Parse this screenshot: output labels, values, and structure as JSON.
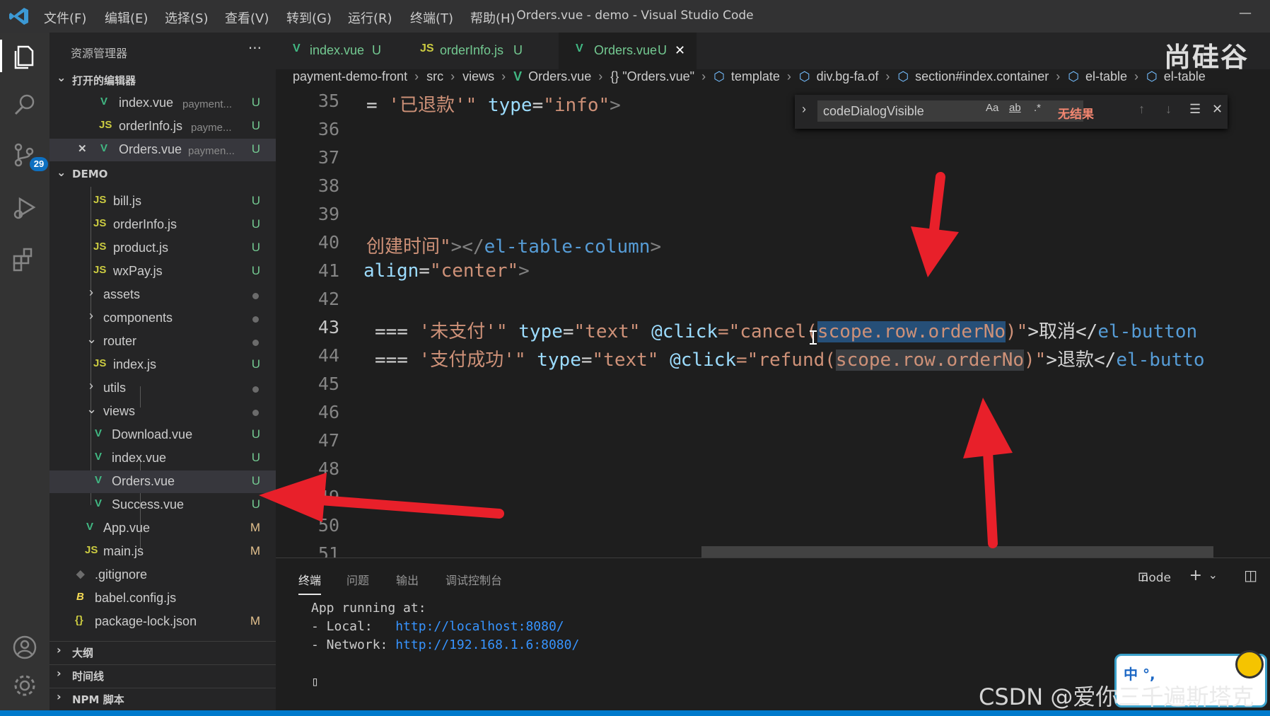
{
  "menu": [
    "文件(F)",
    "编辑(E)",
    "选择(S)",
    "查看(V)",
    "转到(G)",
    "运行(R)",
    "终端(T)",
    "帮助(H)"
  ],
  "window_title": "Orders.vue - demo - Visual Studio Code",
  "activity": {
    "scm_badge": "29"
  },
  "sidebar": {
    "title": "资源管理器",
    "more": "···",
    "open_editors_label": "打开的编辑器",
    "open_editors": [
      {
        "name": "index.vue",
        "hint": "payment...",
        "status": "U",
        "kind": "vue"
      },
      {
        "name": "orderInfo.js",
        "hint": "payme...",
        "status": "U",
        "kind": "js"
      },
      {
        "name": "Orders.vue",
        "hint": "paymen...",
        "status": "U",
        "kind": "vue"
      }
    ],
    "workspace_label": "DEMO",
    "files": [
      {
        "name": "bill.js",
        "status": "U",
        "kind": "js"
      },
      {
        "name": "orderInfo.js",
        "status": "U",
        "kind": "js"
      },
      {
        "name": "product.js",
        "status": "U",
        "kind": "js"
      },
      {
        "name": "wxPay.js",
        "status": "U",
        "kind": "js"
      },
      {
        "name": "assets",
        "kind": "folder-closed"
      },
      {
        "name": "components",
        "kind": "folder-closed"
      },
      {
        "name": "router",
        "kind": "folder-open"
      },
      {
        "name": "index.js",
        "status": "U",
        "kind": "js"
      },
      {
        "name": "utils",
        "kind": "folder-closed"
      },
      {
        "name": "views",
        "kind": "folder-open"
      },
      {
        "name": "Download.vue",
        "status": "U",
        "kind": "vue"
      },
      {
        "name": "index.vue",
        "status": "U",
        "kind": "vue"
      },
      {
        "name": "Orders.vue",
        "status": "U",
        "kind": "vue"
      },
      {
        "name": "Success.vue",
        "status": "U",
        "kind": "vue"
      },
      {
        "name": "App.vue",
        "status": "M",
        "kind": "vue"
      },
      {
        "name": "main.js",
        "status": "M",
        "kind": "js"
      },
      {
        "name": ".gitignore",
        "kind": "git"
      },
      {
        "name": "babel.config.js",
        "kind": "babel"
      },
      {
        "name": "package-lock.json",
        "status": "M",
        "kind": "json"
      }
    ],
    "outline_label": "大纲",
    "timeline_label": "时间线",
    "npm_label": "NPM 脚本"
  },
  "tabs": [
    {
      "name": "index.vue",
      "status": "U",
      "kind": "vue"
    },
    {
      "name": "orderInfo.js",
      "status": "U",
      "kind": "js"
    },
    {
      "name": "Orders.vue",
      "status": "U",
      "kind": "vue",
      "close": "✕"
    }
  ],
  "brand_logo": "尚硅谷",
  "breadcrumb": [
    "payment-demo-front",
    "src",
    "views",
    "Orders.vue",
    "{} \"Orders.vue\"",
    "template",
    "div.bg-fa.of",
    "section#index.container",
    "el-table",
    "el-table"
  ],
  "editor": {
    "line_numbers": [
      "35",
      "36",
      "37",
      "38",
      "39",
      "40",
      "41",
      "42",
      "43",
      "44",
      "45",
      "46",
      "47",
      "48",
      "49",
      "50",
      "51"
    ],
    "current_line": "43",
    "line35": {
      "a": "= ",
      "b": "'已退款'",
      "c": "\" ",
      "d": "type",
      "e": "=",
      "f": "\"info\"",
      "g": ">"
    },
    "line40": {
      "a": "创建时间\"",
      "b": "></",
      "c": "el-table-column",
      "d": ">"
    },
    "line41": {
      "a": "align",
      "b": "=",
      "c": "\"center\"",
      "d": ">"
    },
    "line43": {
      "a": "=== ",
      "b": "'未支付'",
      "c": "\" ",
      "d": "type",
      "e": "=",
      "f": "\"text\" ",
      "g": "@click",
      "h": "=\"cancel(",
      "i": "scope.row.orderNo",
      "j": ")\"",
      "k": ">取消</",
      "l": "el-button"
    },
    "line44": {
      "a": "=== ",
      "b": "'支付成功'",
      "c": "\" ",
      "d": "type",
      "e": "=",
      "f": "\"text\" ",
      "g": "@click",
      "h": "=\"refund(",
      "i": "scope.row.orderNo",
      "j": ")\"",
      "k": ">退款</",
      "l": "el-butto"
    }
  },
  "find": {
    "value": "codeDialogVisible",
    "match_case": "Aa",
    "whole_word": "ab",
    "regex": ".*",
    "no_results": "无结果"
  },
  "panel": {
    "tabs": [
      "终端",
      "问题",
      "输出",
      "调试控制台"
    ],
    "terminal_name": "node",
    "lines": [
      "App running at:",
      "- Local:   ",
      "- Network: "
    ],
    "local_url": "http://localhost:8080/",
    "network_url": "http://192.168.1.6:8080/",
    "cursor": "▯"
  },
  "watermark": "CSDN @爱你三千遍斯塔克",
  "ime": {
    "text": "中 °,"
  },
  "colors": {
    "accent": "#007acc",
    "vue": "#41b883",
    "js": "#cbcb41",
    "arrow": "#e8202a"
  }
}
